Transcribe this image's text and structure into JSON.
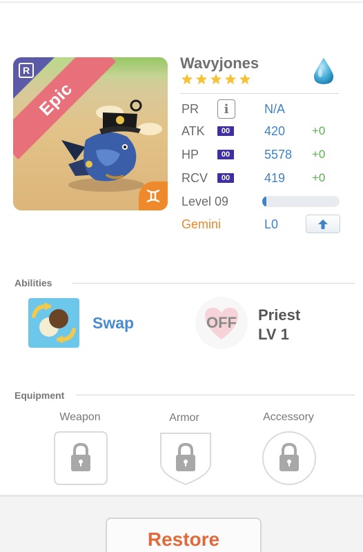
{
  "card": {
    "rarity": "Epic",
    "rank_letter": "R",
    "zodiac_icon": "gemini-icon"
  },
  "unit": {
    "name": "Wavyjones",
    "stars": 5,
    "element_icon": "water-drop-icon"
  },
  "stats": {
    "pr": {
      "label": "PR",
      "value": "N/A"
    },
    "atk": {
      "label": "ATK",
      "badge": "00",
      "value": "420",
      "bonus": "+0"
    },
    "hp": {
      "label": "HP",
      "badge": "00",
      "value": "5578",
      "bonus": "+0"
    },
    "rcv": {
      "label": "RCV",
      "badge": "00",
      "value": "419",
      "bonus": "+0"
    },
    "level": {
      "label": "Level 09",
      "progress": 0.05
    },
    "zodiac": {
      "label": "Gemini",
      "value": "L0"
    }
  },
  "abilities": {
    "title": "Abilities",
    "active": {
      "name": "Swap"
    },
    "leader": {
      "state": "OFF",
      "name": "Priest",
      "level": "LV 1"
    }
  },
  "equipment": {
    "title": "Equipment",
    "slots": [
      {
        "label": "Weapon"
      },
      {
        "label": "Armor"
      },
      {
        "label": "Accessory"
      }
    ]
  },
  "actions": {
    "restore_label": "Restore"
  },
  "colors": {
    "accent_blue": "#3f82c6",
    "bonus_green": "#58b34a",
    "rarity_red": "#e8707a",
    "zodiac_orange": "#e8872a"
  }
}
